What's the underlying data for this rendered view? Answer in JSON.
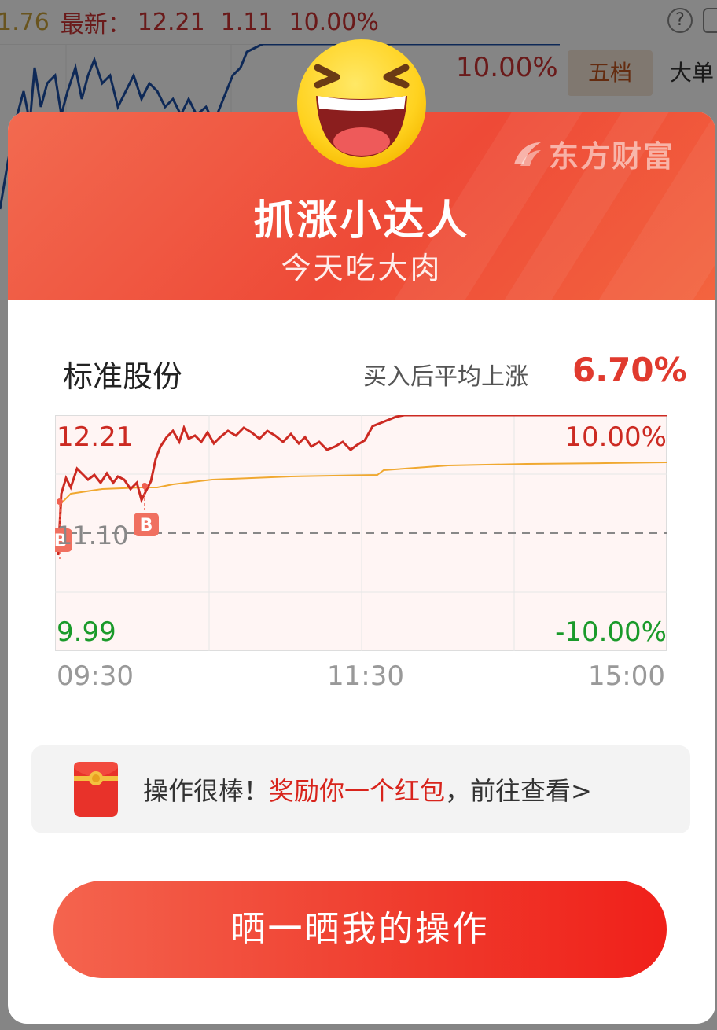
{
  "background": {
    "price_partial": "1.76",
    "latest_label": "最新：",
    "latest_price": "12.21",
    "change": "1.11",
    "change_pct": "10.00%",
    "chart_pct": "10.00%",
    "tab_active": "五档",
    "tab_other": "大单",
    "help_icon": "?"
  },
  "header": {
    "brand": "东方财富",
    "title": "抓涨小达人",
    "subtitle": "今天吃大肉"
  },
  "stock": {
    "name": "标准股份",
    "avg_label": "买入后平均上涨",
    "avg_value": "6.70%"
  },
  "chart_data": {
    "type": "line",
    "price_high": "12.21",
    "price_mid": "11.10",
    "price_low": "9.99",
    "pct_high": "10.00%",
    "pct_low": "-10.00%",
    "times": [
      "09:30",
      "11:30",
      "15:00"
    ],
    "buy_marker": "B",
    "colors": {
      "price": "#cc2a22",
      "avg": "#f0a830",
      "up": "#cc2a22",
      "down": "#1a9a2a"
    }
  },
  "promo": {
    "prefix": "操作很棒！",
    "highlight": "奖励你一个红包",
    "suffix": "，前往查看>"
  },
  "share_button": "晒一晒我的操作"
}
